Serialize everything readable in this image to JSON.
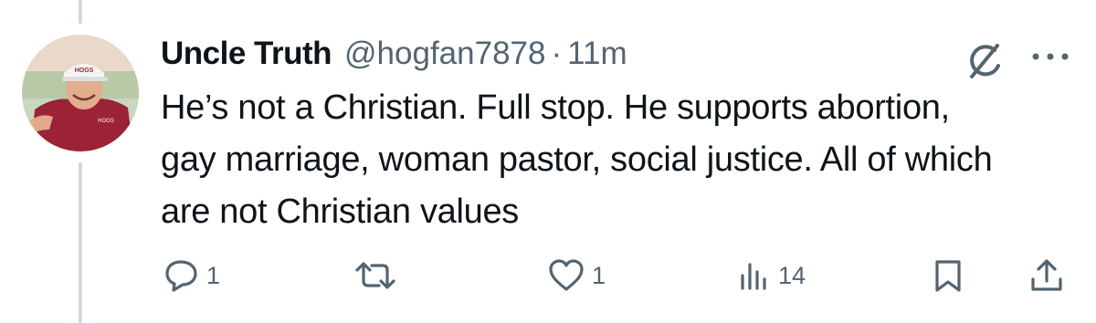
{
  "tweet": {
    "display_name": "Uncle Truth",
    "handle": "@hogfan7878",
    "separator": "·",
    "time": "11m",
    "text": "He’s not a Christian. Full stop. He supports abortion, gay marriage, woman pastor, social justice. All of which are not Christian values"
  },
  "avatar": {
    "cap_text": "HOGS",
    "shirt_text": "HOGS"
  },
  "actions": {
    "reply_count": "1",
    "repost_count": "",
    "like_count": "1",
    "views_count": "14"
  },
  "icons": {
    "grok": "grok-icon",
    "more": "more-icon",
    "reply": "reply-icon",
    "repost": "repost-icon",
    "like": "like-icon",
    "views": "views-icon",
    "bookmark": "bookmark-icon",
    "share": "share-icon"
  },
  "colors": {
    "text_primary": "#0f1419",
    "text_secondary": "#536471",
    "thread_line": "#cfd9de",
    "shirt": "#9b2335"
  }
}
